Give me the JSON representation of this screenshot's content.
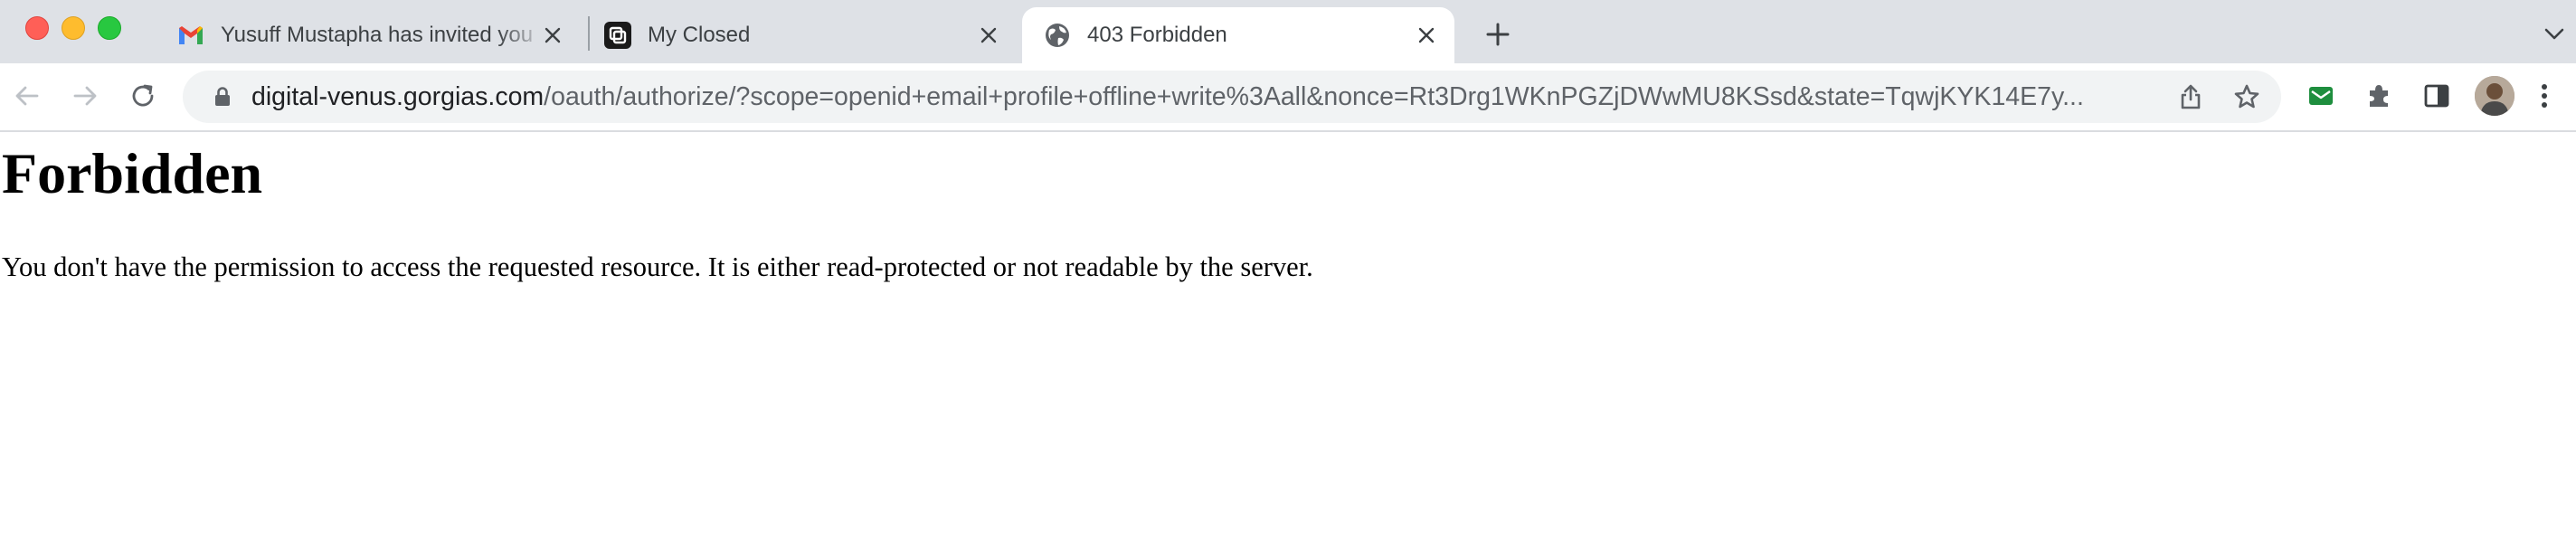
{
  "tabs": [
    {
      "title": "Yusuff Mustapha has invited you",
      "favicon": "gmail-icon",
      "active": false
    },
    {
      "title": "My Closed",
      "favicon": "app-icon",
      "active": false
    },
    {
      "title": "403 Forbidden",
      "favicon": "globe-icon",
      "active": true
    }
  ],
  "toolbar": {
    "url_host": "digital-venus.gorgias.com",
    "url_path": "/oauth/authorize/?scope=openid+email+profile+offline+write%3Aall&nonce=Rt3Drg1WKnPGZjDWwMU8KSsd&state=TqwjKYK14E7y..."
  },
  "page": {
    "heading": "Forbidden",
    "message": "You don't have the permission to access the requested resource. It is either read-protected or not readable by the server."
  },
  "colors": {
    "tabstrip": "#dee1e6",
    "omnibox": "#f1f3f4",
    "ext_green": "#1e8e3e"
  }
}
